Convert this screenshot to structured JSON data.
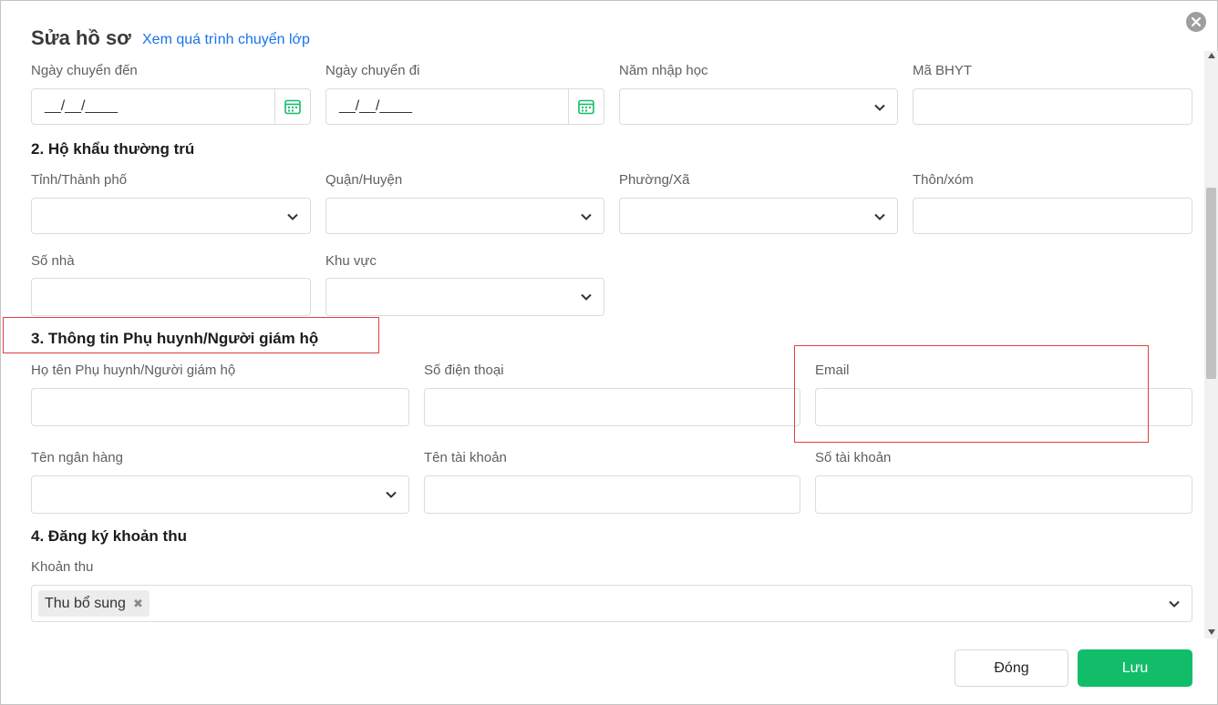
{
  "dialog": {
    "title": "Sửa hồ sơ",
    "history_link": "Xem quá trình chuyển lớp"
  },
  "transfer": {
    "date_in_label": "Ngày chuyển đến",
    "date_in_value": "__/__/____",
    "date_out_label": "Ngày chuyển đi",
    "date_out_value": "__/__/____",
    "year_label": "Năm nhập học",
    "insurance_label": "Mã BHYT"
  },
  "residence": {
    "heading": "2. Hộ khẩu thường trú",
    "province_label": "Tỉnh/Thành phố",
    "district_label": "Quận/Huyện",
    "ward_label": "Phường/Xã",
    "hamlet_label": "Thôn/xóm",
    "house_label": "Số nhà",
    "area_label": "Khu vực"
  },
  "guardian": {
    "heading": "3. Thông tin Phụ huynh/Người giám hộ",
    "name_label": "Họ tên Phụ huynh/Người giám hộ",
    "phone_label": "Số điện thoại",
    "email_label": "Email",
    "bank_label": "Tên ngân hàng",
    "account_name_label": "Tên tài khoản",
    "account_number_label": "Số tài khoản"
  },
  "fees": {
    "heading": "4. Đăng ký khoản thu",
    "label": "Khoản thu",
    "selected": [
      "Thu bổ sung"
    ]
  },
  "footer": {
    "close_label": "Đóng",
    "save_label": "Lưu"
  },
  "colors": {
    "accent_green": "#12bd6a",
    "link_blue": "#1a73e8",
    "highlight_red": "#e0403b"
  }
}
